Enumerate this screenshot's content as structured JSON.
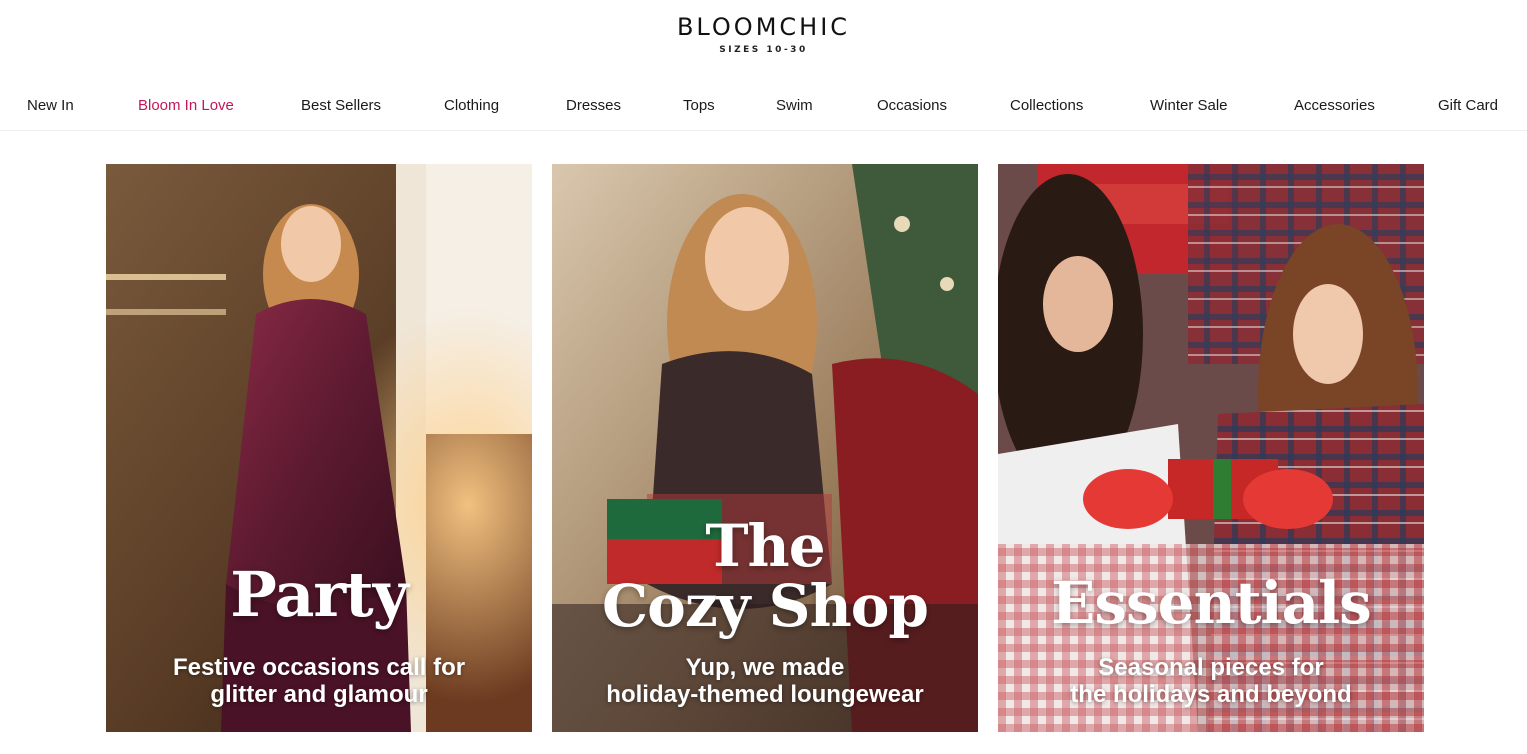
{
  "brand": {
    "name": "BLOOMCHIC",
    "tagline": "SIZES 10-30"
  },
  "nav": [
    {
      "label": "New In"
    },
    {
      "label": "Bloom In Love"
    },
    {
      "label": "Best Sellers"
    },
    {
      "label": "Clothing"
    },
    {
      "label": "Dresses"
    },
    {
      "label": "Tops"
    },
    {
      "label": "Swim"
    },
    {
      "label": "Occasions"
    },
    {
      "label": "Collections"
    },
    {
      "label": "Winter Sale"
    },
    {
      "label": "Accessories"
    },
    {
      "label": "Gift Card"
    }
  ],
  "active_nav_color": "#c2185b",
  "tiles": [
    {
      "title_lines": [
        "Party"
      ],
      "subtitle_lines": [
        "Festive occasions call for",
        "glitter and glamour"
      ]
    },
    {
      "title_lines": [
        "The",
        "Cozy Shop"
      ],
      "subtitle_lines": [
        "Yup, we made",
        "holiday-themed loungewear"
      ]
    },
    {
      "title_lines": [
        "Essentials"
      ],
      "subtitle_lines": [
        "Seasonal pieces for",
        "the holidays and beyond"
      ]
    }
  ]
}
